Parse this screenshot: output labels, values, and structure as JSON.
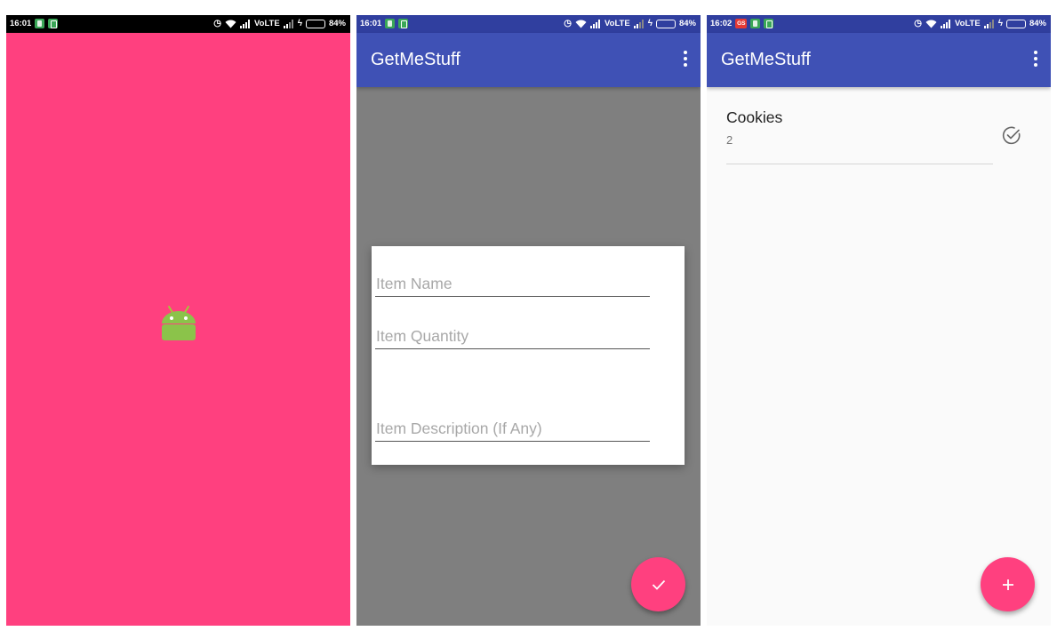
{
  "screens": [
    {
      "id": "splash",
      "status_bar": {
        "time": "16:01",
        "network": "VoLTE",
        "battery": "84%"
      },
      "background_color": "#ff407f",
      "logo_icon": "android-robot-icon"
    },
    {
      "id": "add-item",
      "status_bar": {
        "time": "16:01",
        "network": "VoLTE",
        "battery": "84%"
      },
      "app_title": "GetMeStuff",
      "menu_icon": "more-vert-icon",
      "dialog": {
        "fields": [
          {
            "placeholder": "Item Name"
          },
          {
            "placeholder": "Item Quantity"
          },
          {
            "placeholder": "Item Description (If Any)"
          }
        ]
      },
      "fab_icon": "check-icon"
    },
    {
      "id": "list",
      "status_bar": {
        "time": "16:02",
        "notification": "GS",
        "network": "VoLTE",
        "battery": "84%"
      },
      "app_title": "GetMeStuff",
      "menu_icon": "more-vert-icon",
      "items": [
        {
          "name": "Cookies",
          "quantity": "2",
          "icon": "check-circle-icon"
        }
      ],
      "fab_icon": "plus-icon"
    }
  ],
  "colors": {
    "primary": "#3f51b5",
    "primary_dark": "#303f9f",
    "accent": "#ff407f",
    "overlay": "#7f7f7f"
  },
  "battery_level": 0.84
}
